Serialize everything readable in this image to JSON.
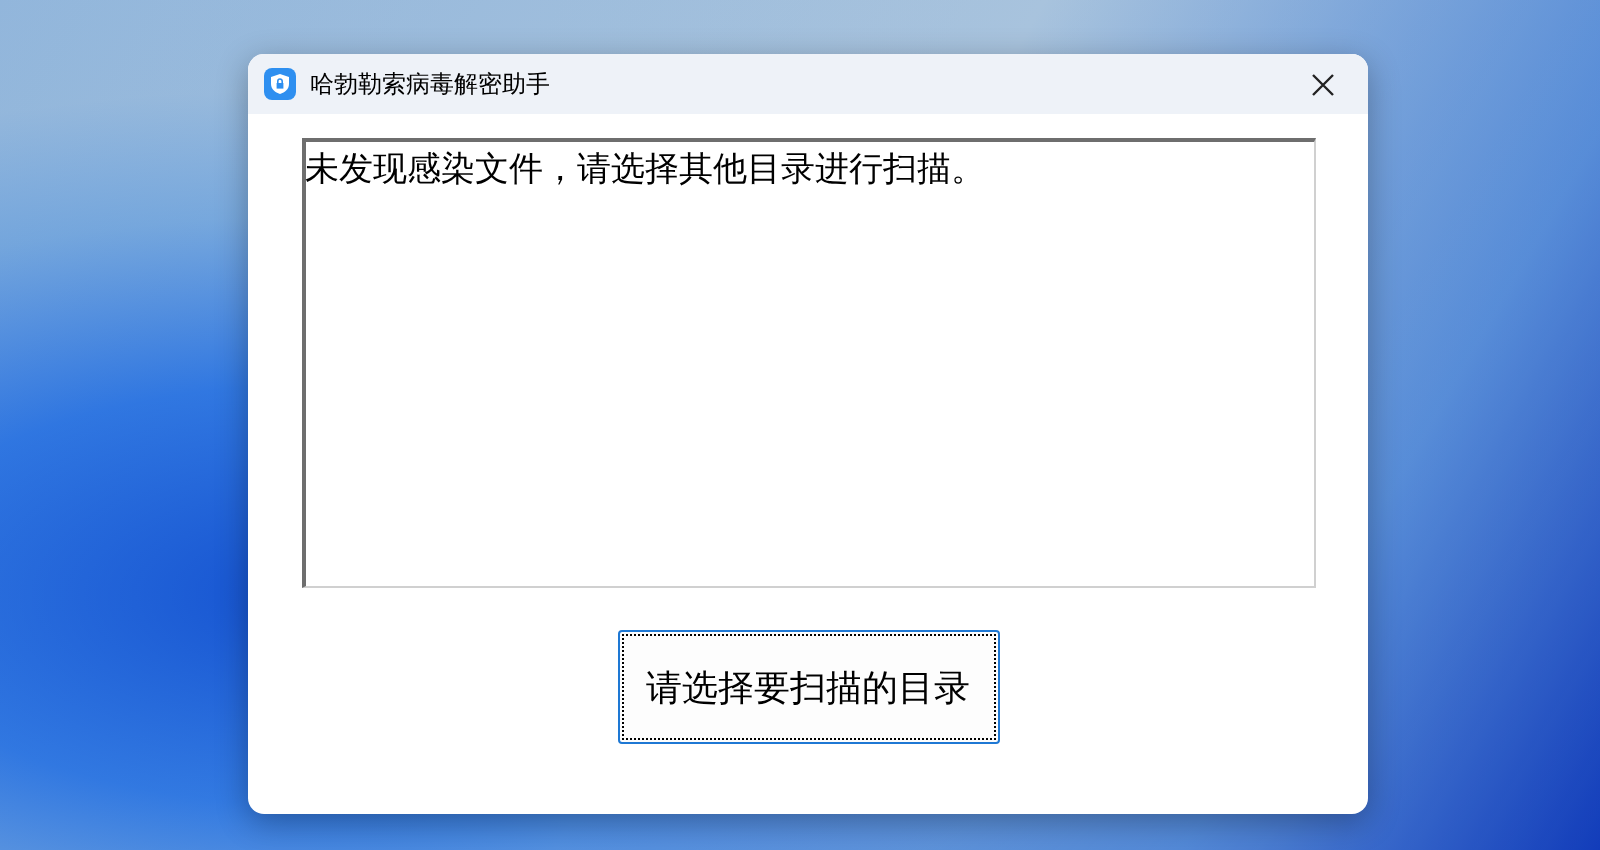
{
  "window": {
    "title": "哈勃勒索病毒解密助手"
  },
  "message_box": {
    "value": "未发现感染文件，请选择其他目录进行扫描。"
  },
  "scan_button": {
    "label": "请选择要扫描的目录"
  }
}
